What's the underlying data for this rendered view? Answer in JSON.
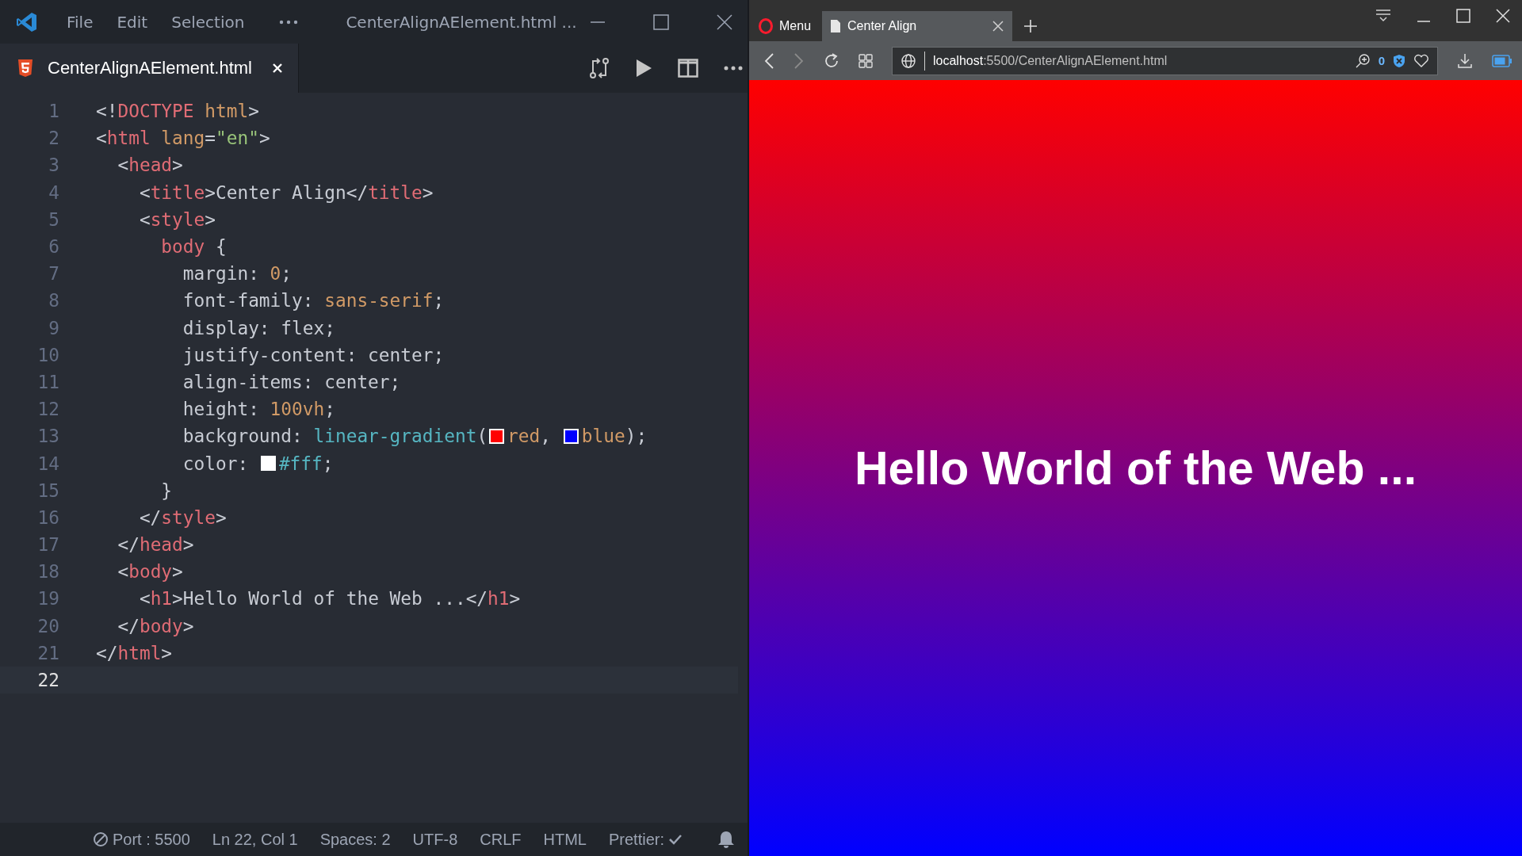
{
  "editor": {
    "menu": [
      "File",
      "Edit",
      "Selection"
    ],
    "window_title": "CenterAlignAElement.html ...",
    "tab": {
      "label": "CenterAlignAElement.html",
      "selected": true
    },
    "lines": [
      {
        "number": "1",
        "current": false,
        "tokens": [
          {
            "kind": "punct",
            "text": "<!"
          },
          {
            "kind": "tag",
            "text": "DOCTYPE"
          },
          {
            "kind": "attr",
            "text": " html"
          },
          {
            "kind": "punct",
            "text": ">"
          }
        ]
      },
      {
        "number": "2",
        "current": false,
        "tokens": [
          {
            "kind": "punct",
            "text": "<"
          },
          {
            "kind": "tag",
            "text": "html"
          },
          {
            "kind": "attr",
            "text": " lang"
          },
          {
            "kind": "punct",
            "text": "="
          },
          {
            "kind": "string",
            "text": "\"en\""
          },
          {
            "kind": "punct",
            "text": ">"
          }
        ]
      },
      {
        "number": "3",
        "current": false,
        "tokens": [
          {
            "kind": "punct",
            "text": "  <"
          },
          {
            "kind": "tag",
            "text": "head"
          },
          {
            "kind": "punct",
            "text": ">"
          }
        ]
      },
      {
        "number": "4",
        "current": false,
        "tokens": [
          {
            "kind": "punct",
            "text": "    <"
          },
          {
            "kind": "tag",
            "text": "title"
          },
          {
            "kind": "punct",
            "text": ">Center Align</"
          },
          {
            "kind": "tag",
            "text": "title"
          },
          {
            "kind": "punct",
            "text": ">"
          }
        ]
      },
      {
        "number": "5",
        "current": false,
        "tokens": [
          {
            "kind": "punct",
            "text": "    <"
          },
          {
            "kind": "tag",
            "text": "style"
          },
          {
            "kind": "punct",
            "text": ">"
          }
        ]
      },
      {
        "number": "6",
        "current": false,
        "tokens": [
          {
            "kind": "tag",
            "text": "      body"
          },
          {
            "kind": "punct",
            "text": " {"
          }
        ]
      },
      {
        "number": "7",
        "current": false,
        "tokens": [
          {
            "kind": "punct",
            "text": "        margin: "
          },
          {
            "kind": "value",
            "text": "0"
          },
          {
            "kind": "punct",
            "text": ";"
          }
        ]
      },
      {
        "number": "8",
        "current": false,
        "tokens": [
          {
            "kind": "punct",
            "text": "        font-family: "
          },
          {
            "kind": "value",
            "text": "sans-serif"
          },
          {
            "kind": "punct",
            "text": ";"
          }
        ]
      },
      {
        "number": "9",
        "current": false,
        "tokens": [
          {
            "kind": "punct",
            "text": "        display: flex;"
          }
        ]
      },
      {
        "number": "10",
        "current": false,
        "tokens": [
          {
            "kind": "punct",
            "text": "        justify-content: center;"
          }
        ]
      },
      {
        "number": "11",
        "current": false,
        "tokens": [
          {
            "kind": "punct",
            "text": "        align-items: center;"
          }
        ]
      },
      {
        "number": "12",
        "current": false,
        "tokens": [
          {
            "kind": "punct",
            "text": "        height: "
          },
          {
            "kind": "value",
            "text": "100vh"
          },
          {
            "kind": "punct",
            "text": ";"
          }
        ]
      },
      {
        "number": "13",
        "current": false,
        "tokens": [
          {
            "kind": "punct",
            "text": "        background: "
          },
          {
            "kind": "func",
            "text": "linear-gradient"
          },
          {
            "kind": "punct",
            "text": "("
          },
          {
            "kind": "swatch",
            "color": "#ff0000"
          },
          {
            "kind": "value",
            "text": "red"
          },
          {
            "kind": "punct",
            "text": ", "
          },
          {
            "kind": "swatch",
            "color": "#0000ff"
          },
          {
            "kind": "value",
            "text": "blue"
          },
          {
            "kind": "punct",
            "text": ");"
          }
        ]
      },
      {
        "number": "14",
        "current": false,
        "tokens": [
          {
            "kind": "punct",
            "text": "        color: "
          },
          {
            "kind": "swatch",
            "color": "#ffffff"
          },
          {
            "kind": "func",
            "text": "#fff"
          },
          {
            "kind": "punct",
            "text": ";"
          }
        ]
      },
      {
        "number": "15",
        "current": false,
        "tokens": [
          {
            "kind": "punct",
            "text": "      }"
          }
        ]
      },
      {
        "number": "16",
        "current": false,
        "tokens": [
          {
            "kind": "punct",
            "text": "    </"
          },
          {
            "kind": "tag",
            "text": "style"
          },
          {
            "kind": "punct",
            "text": ">"
          }
        ]
      },
      {
        "number": "17",
        "current": false,
        "tokens": [
          {
            "kind": "punct",
            "text": "  </"
          },
          {
            "kind": "tag",
            "text": "head"
          },
          {
            "kind": "punct",
            "text": ">"
          }
        ]
      },
      {
        "number": "18",
        "current": false,
        "tokens": [
          {
            "kind": "punct",
            "text": "  <"
          },
          {
            "kind": "tag",
            "text": "body"
          },
          {
            "kind": "punct",
            "text": ">"
          }
        ]
      },
      {
        "number": "19",
        "current": false,
        "tokens": [
          {
            "kind": "punct",
            "text": "    <"
          },
          {
            "kind": "tag",
            "text": "h1"
          },
          {
            "kind": "punct",
            "text": ">Hello World of the Web ...</"
          },
          {
            "kind": "tag",
            "text": "h1"
          },
          {
            "kind": "punct",
            "text": ">"
          }
        ]
      },
      {
        "number": "20",
        "current": false,
        "tokens": [
          {
            "kind": "punct",
            "text": "  </"
          },
          {
            "kind": "tag",
            "text": "body"
          },
          {
            "kind": "punct",
            "text": ">"
          }
        ]
      },
      {
        "number": "21",
        "current": false,
        "tokens": [
          {
            "kind": "punct",
            "text": "</"
          },
          {
            "kind": "tag",
            "text": "html"
          },
          {
            "kind": "punct",
            "text": ">"
          }
        ]
      },
      {
        "number": "22",
        "current": true
      }
    ],
    "status_bar": [
      "Port : 5500",
      "Ln 22, Col 1",
      "Spaces: 2",
      "UTF-8",
      "CRLF",
      "HTML",
      "Prettier:"
    ]
  },
  "browser": {
    "menu": "Menu",
    "tabs": [
      {
        "label": "Center Align",
        "selected": true
      }
    ],
    "address": {
      "host": "localhost",
      "path": ":5500/CenterAlignAElement.html"
    },
    "blocked_count": "0",
    "page": {
      "heading": "Hello World of the Web ..."
    }
  }
}
